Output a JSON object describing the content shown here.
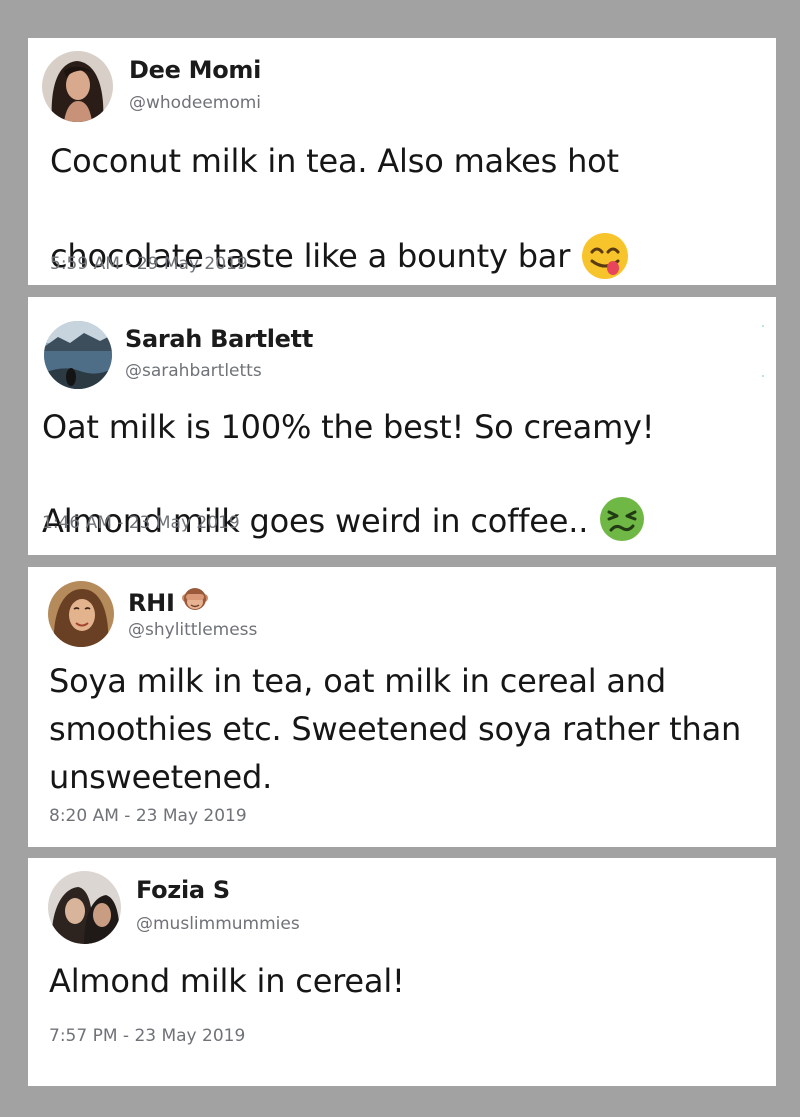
{
  "tweets": [
    {
      "name": "Dee Momi",
      "handle": "@whodeemomi",
      "text": "Coconut milk in tea. Also makes hot\nchocolate taste like a bounty bar",
      "emoji": "face-savoring-food-emoji",
      "timestamp": "5:59 AM - 29 May 2019"
    },
    {
      "name": "Sarah Bartlett",
      "handle": "@sarahbartletts",
      "text": "Oat milk is 100% the best! So creamy!\nAlmond milk goes weird in coffee..",
      "emoji": "nauseated-face-emoji",
      "timestamp": "1:46 AM - 23 May 2019"
    },
    {
      "name": "RHI",
      "name_emoji": "see-no-evil-monkey-emoji",
      "handle": "@shylittlemess",
      "text": "Soya milk in tea, oat milk in cereal and\nsmoothies etc. Sweetened soya rather than\nunsweetened.",
      "timestamp": "8:20 AM - 23 May 2019"
    },
    {
      "name": "Fozia S",
      "handle": "@muslimmummies",
      "text": "Almond milk in cereal!",
      "timestamp": "7:57 PM - 23 May 2019"
    }
  ],
  "colors": {
    "background": "#a2a2a2",
    "card": "#ffffff",
    "text": "#161616",
    "secondary_text": "#6f7378"
  }
}
